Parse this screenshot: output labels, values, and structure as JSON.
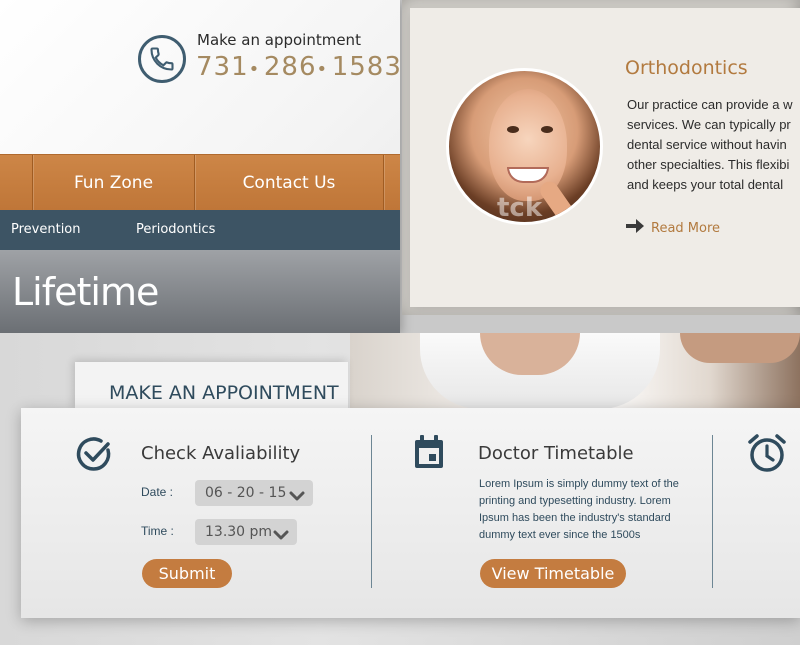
{
  "header": {
    "appointment_label": "Make an appointment",
    "phone_parts": [
      "731",
      "286",
      "1583"
    ]
  },
  "nav_main": {
    "items": [
      {
        "label": "Fun Zone"
      },
      {
        "label": "Contact Us"
      }
    ]
  },
  "nav_sub": {
    "items": [
      {
        "label": "Prevention"
      },
      {
        "label": "Periodontics"
      }
    ]
  },
  "banner": {
    "title": "Lifetime"
  },
  "service": {
    "title": "Orthodontics",
    "lines": [
      "Our practice can provide a w",
      "services. We can typically pr",
      "dental service without havin",
      "other specialties. This flexibi",
      "and keeps your total dental"
    ],
    "read_more": "Read More",
    "watermark": "tck"
  },
  "appointment": {
    "tab_title": "MAKE AN APPOINTMENT",
    "check": {
      "title": "Check Avaliability",
      "date_label": "Date :",
      "date_value": "06 - 20 - 15",
      "time_label": "Time :",
      "time_value": "13.30 pm",
      "submit": "Submit"
    },
    "timetable": {
      "title": "Doctor Timetable",
      "text": "Lorem Ipsum is simply dummy text of the\nprinting and typesetting industry. Lorem\nIpsum has been the industry's standard\ndummy text ever since the 1500s",
      "button": "View Timetable"
    }
  },
  "colors": {
    "accent_orange": "#c47c40",
    "nav_orange": "#c67d3e",
    "nav_dark": "#3d5464",
    "text_gold": "#a58a61",
    "icon_blue": "#2f4b5d"
  },
  "icons": {
    "phone": "phone-icon",
    "read_more": "arrow-right-icon",
    "check": "check-circle-icon",
    "calendar": "calendar-icon",
    "clock": "alarm-clock-icon",
    "dropdown": "chevron-down-icon"
  }
}
